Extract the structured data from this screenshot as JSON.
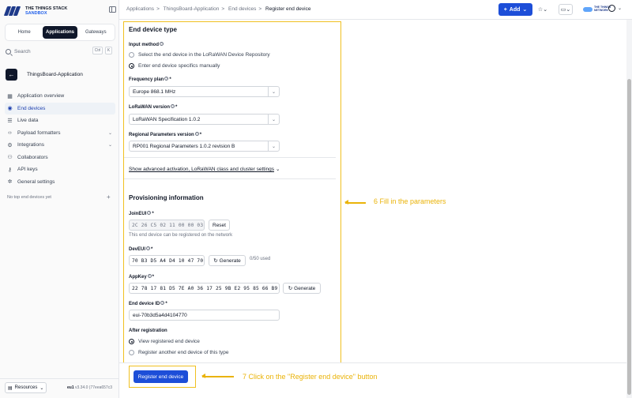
{
  "brand": {
    "line1": "THE THINGS STACK",
    "line2": "SANDBOX"
  },
  "sidebar": {
    "tabs": [
      {
        "label": "Home"
      },
      {
        "label": "Applications"
      },
      {
        "label": "Gateways"
      }
    ],
    "search": {
      "placeholder": "Search",
      "kbd1": "Ctrl",
      "kbd2": "K"
    },
    "app_name": "ThingsBoard-Application",
    "items": [
      {
        "label": "Application overview",
        "icon": "grid-icon"
      },
      {
        "label": "End devices",
        "icon": "devices-icon"
      },
      {
        "label": "Live data",
        "icon": "list-icon"
      },
      {
        "label": "Payload formatters",
        "icon": "code-icon"
      },
      {
        "label": "Integrations",
        "icon": "integrations-icon"
      },
      {
        "label": "Collaborators",
        "icon": "users-icon"
      },
      {
        "label": "API keys",
        "icon": "key-icon"
      },
      {
        "label": "General settings",
        "icon": "gear-icon"
      }
    ],
    "top_devices": "No top end devices yet",
    "resources": "Resources",
    "cluster": "eu1",
    "version": "v3.34.0 (77eea657c3"
  },
  "header": {
    "breadcrumbs": [
      "Applications",
      "ThingsBoard-Application",
      "End devices",
      "Register end device"
    ],
    "add_label": "Add",
    "user_logo": [
      "THE THINGS",
      "NETWORK"
    ]
  },
  "form": {
    "section1_title": "End device type",
    "input_method_label": "Input method",
    "input_method_options": [
      "Select the end device in the LoRaWAN Device Repository",
      "Enter end device specifics manually"
    ],
    "frequency_plan_label": "Frequency plan",
    "frequency_plan_value": "Europe 868.1 MHz",
    "lorawan_version_label": "LoRaWAN version",
    "lorawan_version_value": "LoRaWAN Specification 1.0.2",
    "regional_params_label": "Regional Parameters version",
    "regional_params_value": "RP001 Regional Parameters 1.0.2 revision B",
    "advanced_link": "Show advanced activation, LoRaWAN class and cluster settings",
    "section2_title": "Provisioning information",
    "joineui_label": "JoinEUI",
    "joineui_value": "2C 26 C5 02 11 00 00 03",
    "reset_label": "Reset",
    "joineui_hint": "This end device can be registered on the network",
    "deveui_label": "DevEUI",
    "deveui_value": "70 B3 D5 A4 D4 10 47 70",
    "generate_label": "Generate",
    "deveui_used": "0/50 used",
    "appkey_label": "AppKey",
    "appkey_value": "22 78 17 81 D5 7E A0 36 17 25 9B E2 95 85 66 B9",
    "device_id_label": "End device ID",
    "device_id_value": "eui-70b3d5a4d4104770",
    "after_reg_label": "After registration",
    "after_reg_options": [
      "View registered end device",
      "Register another end device of this type"
    ],
    "register_button": "Register end device"
  },
  "annotations": {
    "step6": "6 Fill in the parameters",
    "step7": "7 Click on the \"Register end device\" button"
  },
  "colors": {
    "accent": "#1d4ed8",
    "annotation": "#eab308",
    "dark": "#0f172a"
  }
}
